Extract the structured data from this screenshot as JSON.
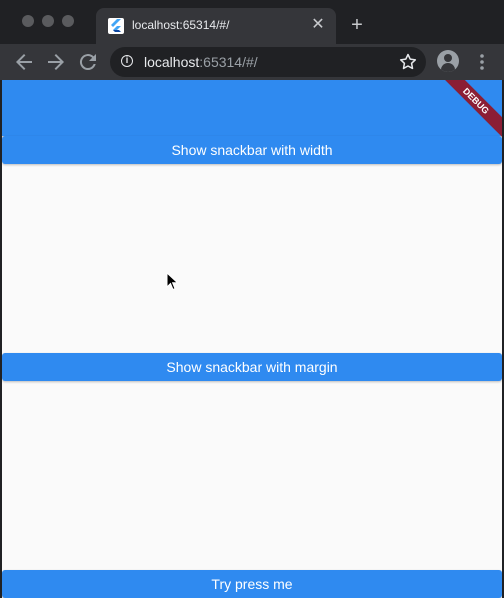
{
  "browser": {
    "tab_title": "localhost:65314/#/",
    "url_host": "localhost",
    "url_rest": ":65314/#/",
    "tab_close_glyph": "✕",
    "new_tab_glyph": "+",
    "icons": [
      "back-arrow-icon",
      "forward-arrow-icon",
      "reload-icon",
      "info-icon",
      "star-icon",
      "profile-avatar-icon",
      "kebab-menu-icon",
      "flutter-logo-icon"
    ]
  },
  "app": {
    "debug_label": "DEBUG",
    "buttons": {
      "width_label": "Show snackbar with width",
      "margin_label": "Show snackbar with margin",
      "try_label": "Try press me"
    }
  },
  "colors": {
    "accent": "#2f8af0",
    "debug_ribbon": "#8b1e35",
    "chrome_dark": "#202124",
    "toolbar": "#35363a",
    "page_bg": "#fafafa"
  }
}
